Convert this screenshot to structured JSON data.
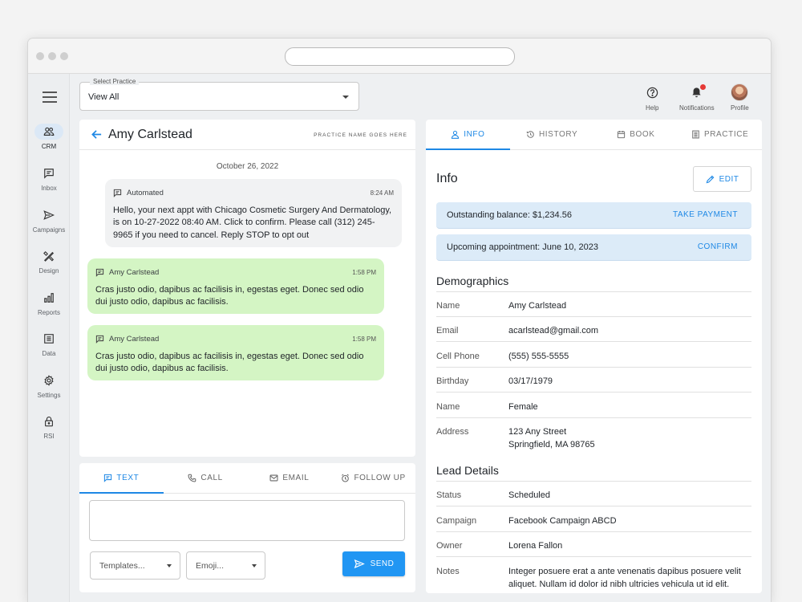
{
  "select_practice": {
    "label": "Select Practice",
    "value": "View All"
  },
  "top_actions": [
    {
      "label": "Help",
      "icon": "help-icon"
    },
    {
      "label": "Notifications",
      "icon": "bell-icon"
    },
    {
      "label": "Profile",
      "icon": "avatar"
    }
  ],
  "sidenav": [
    {
      "label": "CRM",
      "icon": "people-icon",
      "active": true
    },
    {
      "label": "Inbox",
      "icon": "inbox-icon"
    },
    {
      "label": "Campaigns",
      "icon": "send-icon"
    },
    {
      "label": "Design",
      "icon": "design-icon"
    },
    {
      "label": "Reports",
      "icon": "bar-chart-icon"
    },
    {
      "label": "Data",
      "icon": "data-icon"
    },
    {
      "label": "Settings",
      "icon": "gear-icon"
    },
    {
      "label": "RSI",
      "icon": "lock-icon"
    }
  ],
  "conversation": {
    "contact_name": "Amy Carlstead",
    "practice_name": "PRACTICE NAME GOES HERE",
    "date": "October 26, 2022",
    "messages": [
      {
        "sender": "Automated",
        "time": "8:24 AM",
        "text": "Hello, your next appt with Chicago Cosmetic Surgery And Dermatology, is on 10-27-2022 08:40 AM. Click to confirm. Please call (312) 245-9965 if you need to cancel. Reply STOP to opt out"
      },
      {
        "sender": "Amy Carlstead",
        "time": "1:58 PM",
        "text": "Cras justo odio, dapibus ac facilisis in, egestas eget. Donec sed odio dui justo odio, dapibus ac facilisis."
      },
      {
        "sender": "Amy Carlstead",
        "time": "1:58 PM",
        "text": "Cras justo odio, dapibus ac facilisis in, egestas eget. Donec sed odio dui justo odio, dapibus ac facilisis."
      }
    ]
  },
  "compose": {
    "tabs": [
      "TEXT",
      "CALL",
      "EMAIL",
      "FOLLOW UP"
    ],
    "active_tab": "TEXT",
    "templates_placeholder": "Templates...",
    "emoji_placeholder": "Emoji...",
    "send_label": "SEND"
  },
  "detail": {
    "tabs": [
      "INFO",
      "HISTORY",
      "BOOK",
      "PRACTICE"
    ],
    "active_tab": "INFO",
    "title": "Info",
    "edit_label": "EDIT",
    "balance": {
      "text": "Outstanding balance: $1,234.56",
      "action": "TAKE PAYMENT"
    },
    "appointment": {
      "text": "Upcoming appointment: June 10, 2023",
      "action": "CONFIRM"
    },
    "demographics_title": "Demographics",
    "demographics": [
      {
        "label": "Name",
        "value": "Amy Carlstead"
      },
      {
        "label": "Email",
        "value": "acarlstead@gmail.com"
      },
      {
        "label": "Cell Phone",
        "value": "(555) 555-5555"
      },
      {
        "label": "Birthday",
        "value": "03/17/1979"
      },
      {
        "label": "Name",
        "value": "Female"
      },
      {
        "label": "Address",
        "value": "123 Any Street",
        "value2": "Springfield, MA 98765"
      }
    ],
    "lead_title": "Lead Details",
    "lead": [
      {
        "label": "Status",
        "value": "Scheduled"
      },
      {
        "label": "Campaign",
        "value": "Facebook Campaign ABCD"
      },
      {
        "label": "Owner",
        "value": "Lorena Fallon"
      },
      {
        "label": "Notes",
        "value": "Integer posuere erat a ante venenatis dapibus posuere velit aliquet. Nullam id dolor id nibh ultricies vehicula ut id elit."
      }
    ]
  },
  "colors": {
    "accent": "#1e88e5",
    "incoming_bubble": "#d4f5c4",
    "alert_bg": "#dcebf8"
  }
}
